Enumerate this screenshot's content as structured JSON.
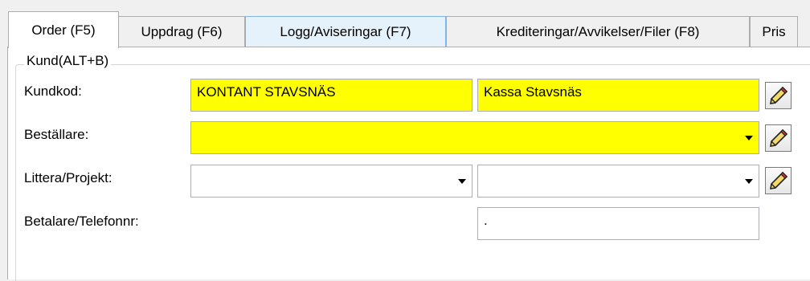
{
  "tabs": [
    {
      "label": "Order (F5)",
      "active": true
    },
    {
      "label": "Uppdrag (F6)",
      "active": false
    },
    {
      "label": "Logg/Aviseringar (F7)",
      "active": false
    },
    {
      "label": "Krediteringar/Avvikelser/Filer (F8)",
      "active": false
    },
    {
      "label": "Pris",
      "active": false
    }
  ],
  "group": {
    "label": "Kund(ALT+B)"
  },
  "form": {
    "kundkod": {
      "label": "Kundkod:",
      "code": "KONTANT STAVSNÄS",
      "name": "Kassa Stavsnäs"
    },
    "bestallare": {
      "label": "Beställare:",
      "value": ""
    },
    "littera": {
      "label": "Littera/Projekt:",
      "value1": "",
      "value2": ""
    },
    "betalare": {
      "label": "Betalare/Telefonnr:",
      "value": "."
    }
  },
  "colors": {
    "required_field": "#ffff00",
    "hover_tab": "#e5f1fb"
  },
  "icons": {
    "edit": "pencil-icon",
    "dropdown": "chevron-down-icon"
  }
}
